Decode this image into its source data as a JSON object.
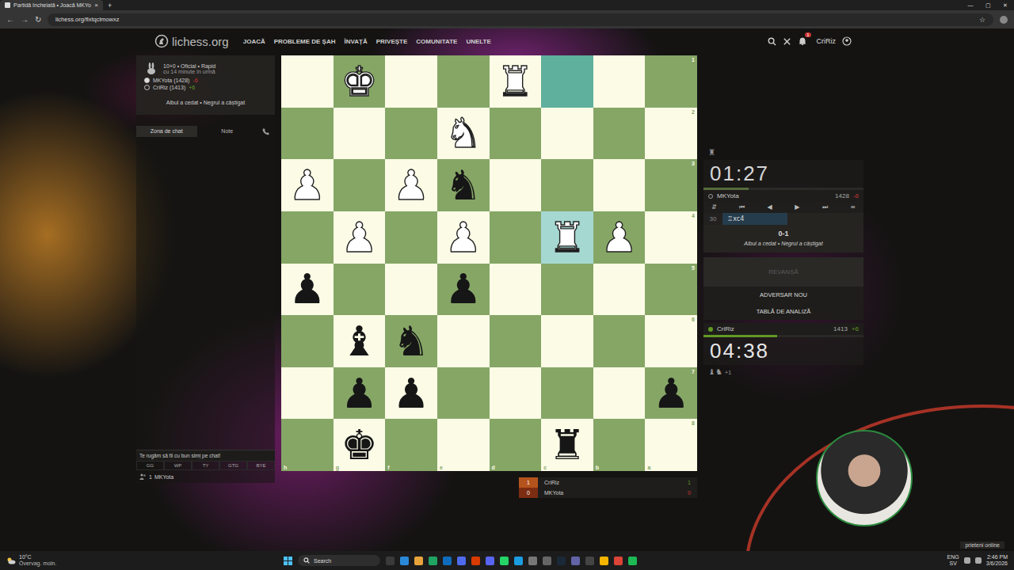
{
  "browser": {
    "tab_title": "Partidă încheiată • Joacă MKYo",
    "tab_close": "×",
    "new_tab": "+",
    "window_controls": [
      "—",
      "▢",
      "✕"
    ],
    "nav_buttons": [
      "←",
      "→",
      "↻"
    ],
    "url": "lichess.org/flxtqclmowxz",
    "bookmark": "☆"
  },
  "site": {
    "logo": "lichess.org",
    "nav": [
      "JOACĂ",
      "PROBLEME DE ȘAH",
      "ÎNVAȚĂ",
      "PRIVEȘTE",
      "COMUNITATE",
      "UNELTE"
    ],
    "notification_count": "1",
    "user": "CriRiz"
  },
  "game_info": {
    "time_control": "10+0 • Oficial • Rapid",
    "when": "cu 14 minute în urmă",
    "players": [
      {
        "name": "MKYota (1428)",
        "diff": "-6",
        "filled": true,
        "color": "#cc3333"
      },
      {
        "name": "CriRiz (1413)",
        "diff": "+6",
        "filled": false,
        "color": "#629924"
      }
    ],
    "result": "Albul a cedat • Negrul a câștigat"
  },
  "chat": {
    "tabs": [
      {
        "label": "Zona de chat",
        "selected": true
      },
      {
        "label": "Note",
        "selected": false
      }
    ],
    "placeholder": "Te rugăm să fii cu bun simț pe chat!",
    "presets": [
      "GG",
      "WP",
      "TY",
      "GTG",
      "BYE"
    ],
    "spectators": {
      "count": "1",
      "names": "MKYota"
    }
  },
  "board": {
    "ranks": [
      "1",
      "2",
      "3",
      "4",
      "5",
      "6",
      "7",
      "8"
    ],
    "files": [
      "h",
      "g",
      "f",
      "e",
      "d",
      "c",
      "b",
      "a"
    ],
    "rows": [
      [
        {
          "piece": "",
          "side": "",
          "highlight": "none"
        },
        {
          "piece": "♚",
          "side": "white",
          "highlight": "none"
        },
        {
          "piece": "",
          "side": "",
          "highlight": "none"
        },
        {
          "piece": "",
          "side": "",
          "highlight": "none"
        },
        {
          "piece": "♜",
          "side": "white",
          "highlight": "none"
        },
        {
          "piece": "",
          "side": "",
          "highlight": "from"
        },
        {
          "piece": "",
          "side": "",
          "highlight": "none"
        },
        {
          "piece": "",
          "side": "",
          "highlight": "none"
        }
      ],
      [
        {
          "piece": "",
          "side": "",
          "highlight": "none"
        },
        {
          "piece": "",
          "side": "",
          "highlight": "none"
        },
        {
          "piece": "",
          "side": "",
          "highlight": "none"
        },
        {
          "piece": "♞",
          "side": "white",
          "highlight": "none"
        },
        {
          "piece": "",
          "side": "",
          "highlight": "none"
        },
        {
          "piece": "",
          "side": "",
          "highlight": "none"
        },
        {
          "piece": "",
          "side": "",
          "highlight": "none"
        },
        {
          "piece": "",
          "side": "",
          "highlight": "none"
        }
      ],
      [
        {
          "piece": "♟",
          "side": "white",
          "highlight": "none"
        },
        {
          "piece": "",
          "side": "",
          "highlight": "none"
        },
        {
          "piece": "♟",
          "side": "white",
          "highlight": "none"
        },
        {
          "piece": "♞",
          "side": "black",
          "highlight": "none"
        },
        {
          "piece": "",
          "side": "",
          "highlight": "none"
        },
        {
          "piece": "",
          "side": "",
          "highlight": "none"
        },
        {
          "piece": "",
          "side": "",
          "highlight": "none"
        },
        {
          "piece": "",
          "side": "",
          "highlight": "none"
        }
      ],
      [
        {
          "piece": "",
          "side": "",
          "highlight": "none"
        },
        {
          "piece": "♟",
          "side": "white",
          "highlight": "none"
        },
        {
          "piece": "",
          "side": "",
          "highlight": "none"
        },
        {
          "piece": "♟",
          "side": "white",
          "highlight": "none"
        },
        {
          "piece": "",
          "side": "",
          "highlight": "none"
        },
        {
          "piece": "♜",
          "side": "white",
          "highlight": "to"
        },
        {
          "piece": "♟",
          "side": "white",
          "highlight": "none"
        },
        {
          "piece": "",
          "side": "",
          "highlight": "none"
        }
      ],
      [
        {
          "piece": "♟",
          "side": "black",
          "highlight": "none"
        },
        {
          "piece": "",
          "side": "",
          "highlight": "none"
        },
        {
          "piece": "",
          "side": "",
          "highlight": "none"
        },
        {
          "piece": "♟",
          "side": "black",
          "highlight": "none"
        },
        {
          "piece": "",
          "side": "",
          "highlight": "none"
        },
        {
          "piece": "",
          "side": "",
          "highlight": "none"
        },
        {
          "piece": "",
          "side": "",
          "highlight": "none"
        },
        {
          "piece": "",
          "side": "",
          "highlight": "none"
        }
      ],
      [
        {
          "piece": "",
          "side": "",
          "highlight": "none"
        },
        {
          "piece": "♝",
          "side": "black",
          "highlight": "none"
        },
        {
          "piece": "♞",
          "side": "black",
          "highlight": "none"
        },
        {
          "piece": "",
          "side": "",
          "highlight": "none"
        },
        {
          "piece": "",
          "side": "",
          "highlight": "none"
        },
        {
          "piece": "",
          "side": "",
          "highlight": "none"
        },
        {
          "piece": "",
          "side": "",
          "highlight": "none"
        },
        {
          "piece": "",
          "side": "",
          "highlight": "none"
        }
      ],
      [
        {
          "piece": "",
          "side": "",
          "highlight": "none"
        },
        {
          "piece": "♟",
          "side": "black",
          "highlight": "none"
        },
        {
          "piece": "♟",
          "side": "black",
          "highlight": "none"
        },
        {
          "piece": "",
          "side": "",
          "highlight": "none"
        },
        {
          "piece": "",
          "side": "",
          "highlight": "none"
        },
        {
          "piece": "",
          "side": "",
          "highlight": "none"
        },
        {
          "piece": "",
          "side": "",
          "highlight": "none"
        },
        {
          "piece": "♟",
          "side": "black",
          "highlight": "none"
        }
      ],
      [
        {
          "piece": "",
          "side": "",
          "highlight": "none"
        },
        {
          "piece": "♚",
          "side": "black",
          "highlight": "none"
        },
        {
          "piece": "",
          "side": "",
          "highlight": "none"
        },
        {
          "piece": "",
          "side": "",
          "highlight": "none"
        },
        {
          "piece": "",
          "side": "",
          "highlight": "none"
        },
        {
          "piece": "♜",
          "side": "black",
          "highlight": "none"
        },
        {
          "piece": "",
          "side": "",
          "highlight": "none"
        },
        {
          "piece": "",
          "side": "",
          "highlight": "none"
        }
      ]
    ]
  },
  "scoreboard": [
    {
      "score": "1",
      "name": "CriRiz",
      "points": "1",
      "color": "#629924"
    },
    {
      "score": "0",
      "name": "MKYota",
      "points": "0",
      "color": "#cc3333"
    }
  ],
  "opponent": {
    "material": "♜",
    "clock": "01:27",
    "time_level": 0.28,
    "name": "MKYota",
    "rating": "1428",
    "diff": "-6",
    "online": false
  },
  "controls": [
    "⇵",
    "⏮",
    "◀",
    "▶",
    "⏭",
    "≡"
  ],
  "moves": [
    {
      "number": "30",
      "san": "♖xc4",
      "selected": true
    }
  ],
  "result": {
    "score": "0-1",
    "text": "Albul a cedat • Negrul a câștigat"
  },
  "rematch": {
    "label": "REVANȘĂ",
    "disabled": true
  },
  "actions": [
    "ADVERSAR NOU",
    "TABLĂ DE ANALIZĂ"
  ],
  "player": {
    "name": "CriRiz",
    "rating": "1413",
    "diff": "+6",
    "online": true,
    "clock": "04:38",
    "time_level": 0.46,
    "material": "♝♞",
    "material_diff": "+1"
  },
  "friends_button": "prieteni online",
  "taskbar": {
    "temp": "10°C",
    "weather": "Övervag. moln.",
    "search": "Search",
    "languages": [
      "ENG",
      "SV"
    ],
    "time": "2:46 PM",
    "date": "3/6/2026"
  }
}
